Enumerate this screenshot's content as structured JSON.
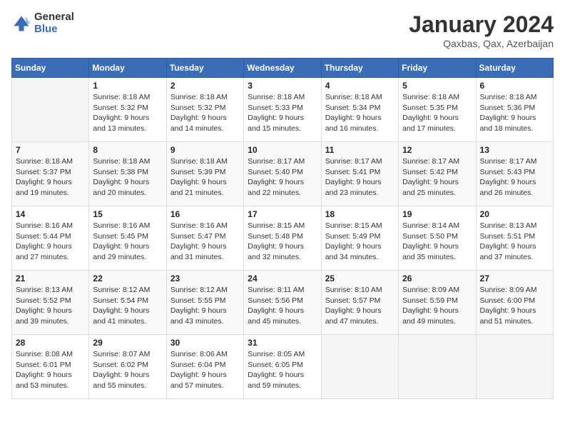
{
  "logo": {
    "general": "General",
    "blue": "Blue"
  },
  "header": {
    "title": "January 2024",
    "subtitle": "Qaxbas, Qax, Azerbaijan"
  },
  "weekdays": [
    "Sunday",
    "Monday",
    "Tuesday",
    "Wednesday",
    "Thursday",
    "Friday",
    "Saturday"
  ],
  "weeks": [
    [
      {
        "day": "",
        "sunrise": "",
        "sunset": "",
        "daylight": ""
      },
      {
        "day": "1",
        "sunrise": "Sunrise: 8:18 AM",
        "sunset": "Sunset: 5:32 PM",
        "daylight": "Daylight: 9 hours and 13 minutes."
      },
      {
        "day": "2",
        "sunrise": "Sunrise: 8:18 AM",
        "sunset": "Sunset: 5:32 PM",
        "daylight": "Daylight: 9 hours and 14 minutes."
      },
      {
        "day": "3",
        "sunrise": "Sunrise: 8:18 AM",
        "sunset": "Sunset: 5:33 PM",
        "daylight": "Daylight: 9 hours and 15 minutes."
      },
      {
        "day": "4",
        "sunrise": "Sunrise: 8:18 AM",
        "sunset": "Sunset: 5:34 PM",
        "daylight": "Daylight: 9 hours and 16 minutes."
      },
      {
        "day": "5",
        "sunrise": "Sunrise: 8:18 AM",
        "sunset": "Sunset: 5:35 PM",
        "daylight": "Daylight: 9 hours and 17 minutes."
      },
      {
        "day": "6",
        "sunrise": "Sunrise: 8:18 AM",
        "sunset": "Sunset: 5:36 PM",
        "daylight": "Daylight: 9 hours and 18 minutes."
      }
    ],
    [
      {
        "day": "7",
        "sunrise": "Sunrise: 8:18 AM",
        "sunset": "Sunset: 5:37 PM",
        "daylight": "Daylight: 9 hours and 19 minutes."
      },
      {
        "day": "8",
        "sunrise": "Sunrise: 8:18 AM",
        "sunset": "Sunset: 5:38 PM",
        "daylight": "Daylight: 9 hours and 20 minutes."
      },
      {
        "day": "9",
        "sunrise": "Sunrise: 8:18 AM",
        "sunset": "Sunset: 5:39 PM",
        "daylight": "Daylight: 9 hours and 21 minutes."
      },
      {
        "day": "10",
        "sunrise": "Sunrise: 8:17 AM",
        "sunset": "Sunset: 5:40 PM",
        "daylight": "Daylight: 9 hours and 22 minutes."
      },
      {
        "day": "11",
        "sunrise": "Sunrise: 8:17 AM",
        "sunset": "Sunset: 5:41 PM",
        "daylight": "Daylight: 9 hours and 23 minutes."
      },
      {
        "day": "12",
        "sunrise": "Sunrise: 8:17 AM",
        "sunset": "Sunset: 5:42 PM",
        "daylight": "Daylight: 9 hours and 25 minutes."
      },
      {
        "day": "13",
        "sunrise": "Sunrise: 8:17 AM",
        "sunset": "Sunset: 5:43 PM",
        "daylight": "Daylight: 9 hours and 26 minutes."
      }
    ],
    [
      {
        "day": "14",
        "sunrise": "Sunrise: 8:16 AM",
        "sunset": "Sunset: 5:44 PM",
        "daylight": "Daylight: 9 hours and 27 minutes."
      },
      {
        "day": "15",
        "sunrise": "Sunrise: 8:16 AM",
        "sunset": "Sunset: 5:45 PM",
        "daylight": "Daylight: 9 hours and 29 minutes."
      },
      {
        "day": "16",
        "sunrise": "Sunrise: 8:16 AM",
        "sunset": "Sunset: 5:47 PM",
        "daylight": "Daylight: 9 hours and 31 minutes."
      },
      {
        "day": "17",
        "sunrise": "Sunrise: 8:15 AM",
        "sunset": "Sunset: 5:48 PM",
        "daylight": "Daylight: 9 hours and 32 minutes."
      },
      {
        "day": "18",
        "sunrise": "Sunrise: 8:15 AM",
        "sunset": "Sunset: 5:49 PM",
        "daylight": "Daylight: 9 hours and 34 minutes."
      },
      {
        "day": "19",
        "sunrise": "Sunrise: 8:14 AM",
        "sunset": "Sunset: 5:50 PM",
        "daylight": "Daylight: 9 hours and 35 minutes."
      },
      {
        "day": "20",
        "sunrise": "Sunrise: 8:13 AM",
        "sunset": "Sunset: 5:51 PM",
        "daylight": "Daylight: 9 hours and 37 minutes."
      }
    ],
    [
      {
        "day": "21",
        "sunrise": "Sunrise: 8:13 AM",
        "sunset": "Sunset: 5:52 PM",
        "daylight": "Daylight: 9 hours and 39 minutes."
      },
      {
        "day": "22",
        "sunrise": "Sunrise: 8:12 AM",
        "sunset": "Sunset: 5:54 PM",
        "daylight": "Daylight: 9 hours and 41 minutes."
      },
      {
        "day": "23",
        "sunrise": "Sunrise: 8:12 AM",
        "sunset": "Sunset: 5:55 PM",
        "daylight": "Daylight: 9 hours and 43 minutes."
      },
      {
        "day": "24",
        "sunrise": "Sunrise: 8:11 AM",
        "sunset": "Sunset: 5:56 PM",
        "daylight": "Daylight: 9 hours and 45 minutes."
      },
      {
        "day": "25",
        "sunrise": "Sunrise: 8:10 AM",
        "sunset": "Sunset: 5:57 PM",
        "daylight": "Daylight: 9 hours and 47 minutes."
      },
      {
        "day": "26",
        "sunrise": "Sunrise: 8:09 AM",
        "sunset": "Sunset: 5:59 PM",
        "daylight": "Daylight: 9 hours and 49 minutes."
      },
      {
        "day": "27",
        "sunrise": "Sunrise: 8:09 AM",
        "sunset": "Sunset: 6:00 PM",
        "daylight": "Daylight: 9 hours and 51 minutes."
      }
    ],
    [
      {
        "day": "28",
        "sunrise": "Sunrise: 8:08 AM",
        "sunset": "Sunset: 6:01 PM",
        "daylight": "Daylight: 9 hours and 53 minutes."
      },
      {
        "day": "29",
        "sunrise": "Sunrise: 8:07 AM",
        "sunset": "Sunset: 6:02 PM",
        "daylight": "Daylight: 9 hours and 55 minutes."
      },
      {
        "day": "30",
        "sunrise": "Sunrise: 8:06 AM",
        "sunset": "Sunset: 6:04 PM",
        "daylight": "Daylight: 9 hours and 57 minutes."
      },
      {
        "day": "31",
        "sunrise": "Sunrise: 8:05 AM",
        "sunset": "Sunset: 6:05 PM",
        "daylight": "Daylight: 9 hours and 59 minutes."
      },
      {
        "day": "",
        "sunrise": "",
        "sunset": "",
        "daylight": ""
      },
      {
        "day": "",
        "sunrise": "",
        "sunset": "",
        "daylight": ""
      },
      {
        "day": "",
        "sunrise": "",
        "sunset": "",
        "daylight": ""
      }
    ]
  ]
}
